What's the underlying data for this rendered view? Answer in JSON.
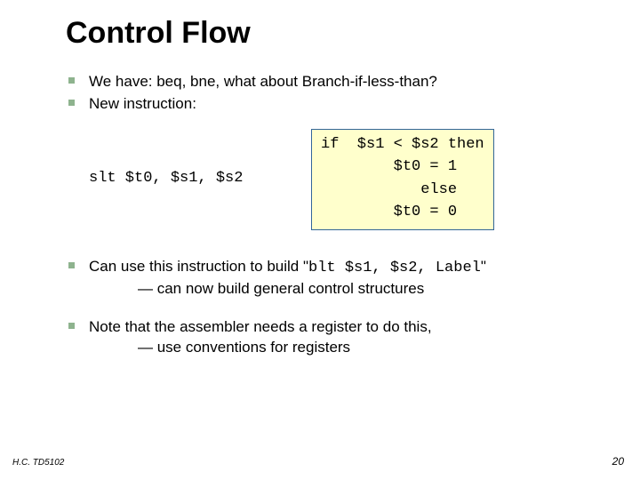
{
  "title": "Control Flow",
  "bullets": {
    "0": "We have: beq, bne, what about Branch-if-less-than?",
    "1": "New instruction:",
    "2a": "Can use this instruction to build",
    "2code": "blt $s1, $s2, Label",
    "2b": "— can now build general control structures",
    "3a": "Note that the assembler needs a register to do this,",
    "3b": "— use conventions for registers"
  },
  "slt_instruction": "slt $t0, $s1, $s2",
  "code": {
    "line1": "if  $s1 < $s2 then",
    "line2": "        $t0 = 1",
    "line3": "           else",
    "line4": "        $t0 = 0"
  },
  "footer": {
    "left": "H.C. TD5102",
    "right": "20"
  }
}
